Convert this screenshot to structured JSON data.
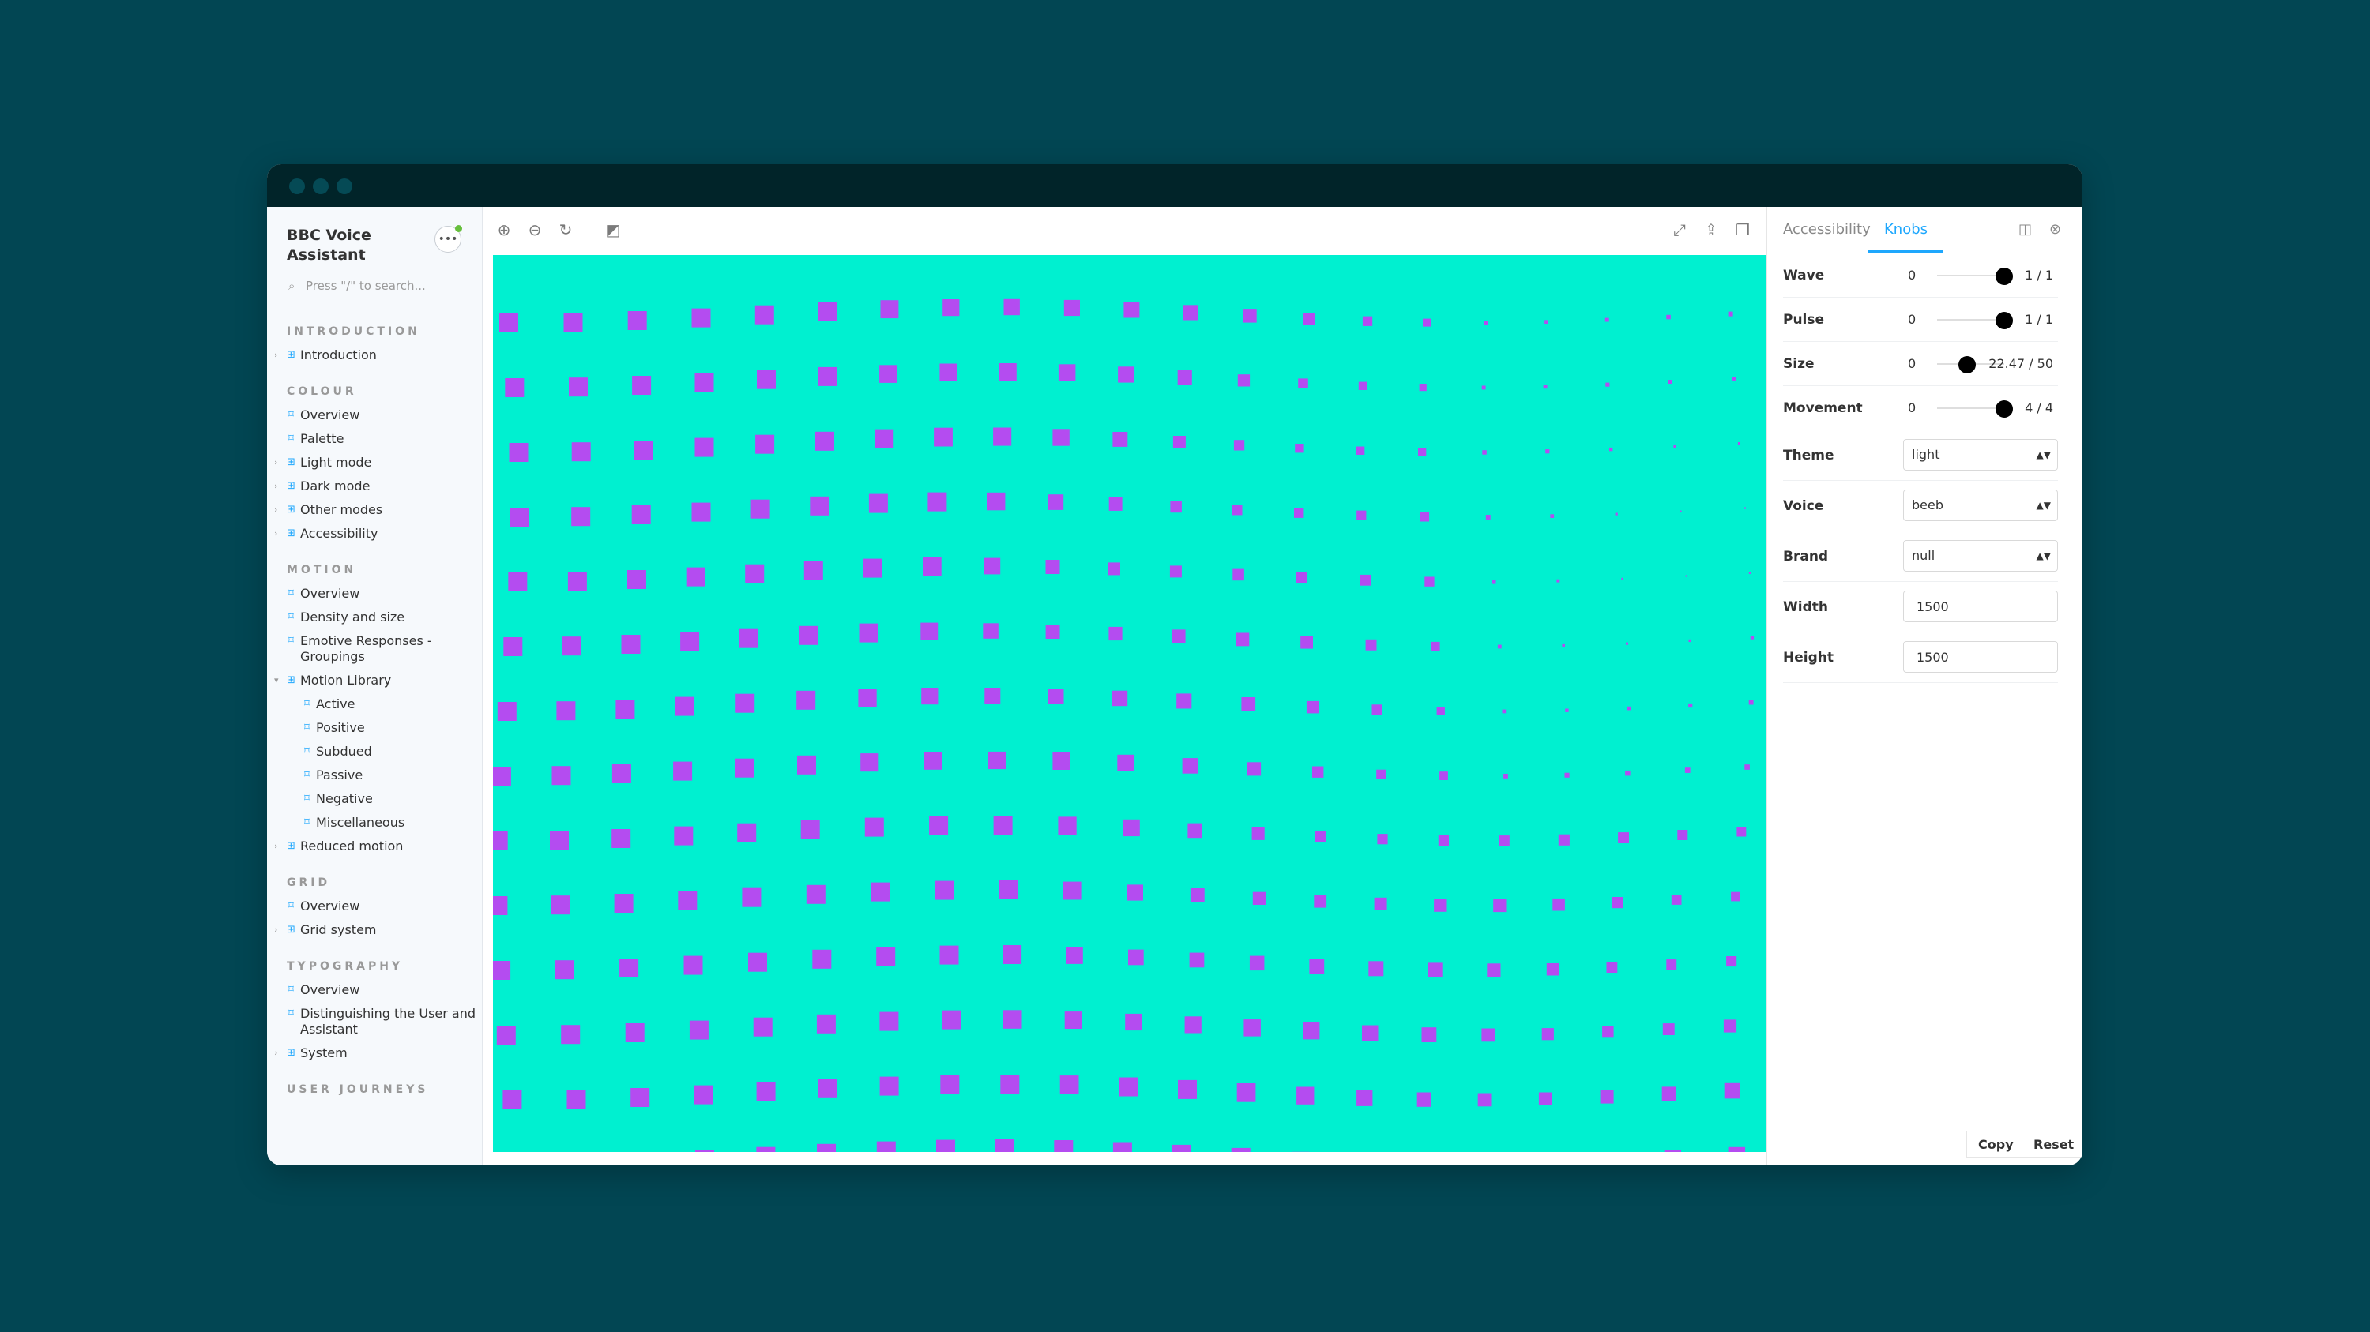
{
  "sidebar": {
    "brand": "BBC Voice Assistant",
    "search_placeholder": "Press \"/\" to search...",
    "sections": [
      {
        "title": "Introduction",
        "items": [
          {
            "label": "Introduction",
            "type": "component",
            "expanded": false
          }
        ]
      },
      {
        "title": "Colour",
        "items": [
          {
            "label": "Overview",
            "type": "doc"
          },
          {
            "label": "Palette",
            "type": "doc"
          },
          {
            "label": "Light mode",
            "type": "component",
            "expanded": false
          },
          {
            "label": "Dark mode",
            "type": "component",
            "expanded": false
          },
          {
            "label": "Other modes",
            "type": "component",
            "expanded": false
          },
          {
            "label": "Accessibility",
            "type": "component",
            "expanded": false
          }
        ]
      },
      {
        "title": "Motion",
        "items": [
          {
            "label": "Overview",
            "type": "doc"
          },
          {
            "label": "Density and size",
            "type": "doc"
          },
          {
            "label": "Emotive Responses - Groupings",
            "type": "doc"
          },
          {
            "label": "Motion Library",
            "type": "component",
            "expanded": true
          },
          {
            "label": "Active",
            "type": "doc",
            "child": true
          },
          {
            "label": "Positive",
            "type": "doc",
            "child": true
          },
          {
            "label": "Subdued",
            "type": "doc",
            "child": true
          },
          {
            "label": "Passive",
            "type": "doc",
            "child": true
          },
          {
            "label": "Negative",
            "type": "doc",
            "child": true
          },
          {
            "label": "Miscellaneous",
            "type": "doc",
            "child": true
          },
          {
            "label": "Reduced motion",
            "type": "component",
            "expanded": false
          }
        ]
      },
      {
        "title": "Grid",
        "items": [
          {
            "label": "Overview",
            "type": "doc"
          },
          {
            "label": "Grid system",
            "type": "component",
            "expanded": false
          }
        ]
      },
      {
        "title": "Typography",
        "items": [
          {
            "label": "Overview",
            "type": "doc"
          },
          {
            "label": "Distinguishing the User and Assistant",
            "type": "doc"
          },
          {
            "label": "System",
            "type": "component",
            "expanded": false
          }
        ]
      },
      {
        "title": "User Journeys",
        "items": []
      }
    ]
  },
  "toolbar": {
    "icons": [
      "zoom-in-icon",
      "zoom-out-icon",
      "reset-zoom-icon",
      "background-icon",
      "fullscreen-icon",
      "share-icon",
      "copy-link-icon"
    ]
  },
  "panel": {
    "tabs": [
      "Accessibility",
      "Knobs"
    ],
    "active_tab": "Knobs",
    "knobs": {
      "wave": {
        "label": "Wave",
        "min": "0",
        "value": 1,
        "max": 1,
        "display": "1 / 1"
      },
      "pulse": {
        "label": "Pulse",
        "min": "0",
        "value": 1,
        "max": 1,
        "display": "1 / 1"
      },
      "size": {
        "label": "Size",
        "min": "0",
        "value": 22.47,
        "max": 50,
        "display": "22.47 / 50"
      },
      "movement": {
        "label": "Movement",
        "min": "0",
        "value": 4,
        "max": 4,
        "display": "4 / 4"
      },
      "theme": {
        "label": "Theme",
        "value": "light"
      },
      "voice": {
        "label": "Voice",
        "value": "beeb"
      },
      "brand": {
        "label": "Brand",
        "value": "null"
      },
      "width": {
        "label": "Width",
        "value": "1500"
      },
      "height": {
        "label": "Height",
        "value": "1500"
      }
    },
    "copy_label": "Copy",
    "reset_label": "Reset"
  },
  "colors": {
    "background": "#024653",
    "canvas": "#00f0d0",
    "dots": "#b44cf0",
    "accent": "#1ea7fd"
  }
}
